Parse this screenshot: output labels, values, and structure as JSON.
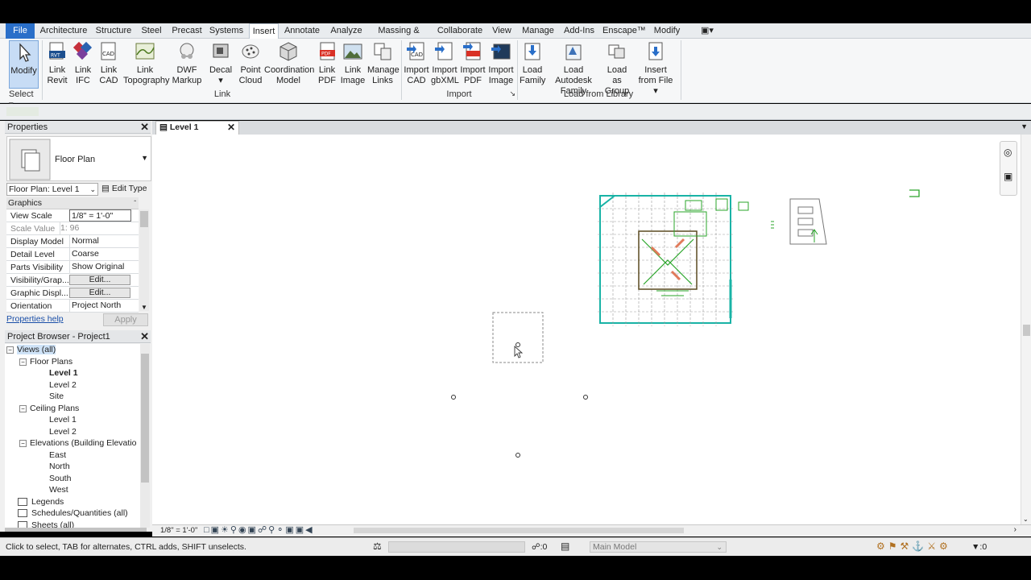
{
  "ribbon_tabs": [
    "File",
    "Architecture",
    "Structure",
    "Steel",
    "Precast",
    "Systems",
    "Insert",
    "Annotate",
    "Analyze",
    "Massing & Site",
    "Collaborate",
    "View",
    "Manage",
    "Add-Ins",
    "Enscape™",
    "Modify"
  ],
  "active_tab": "Insert",
  "buttons": {
    "modify": "Modify",
    "link_revit": [
      "Link",
      "Revit"
    ],
    "link_ifc": [
      "Link",
      "IFC"
    ],
    "link_cad": [
      "Link",
      "CAD"
    ],
    "link_topography": [
      "Link",
      "Topography"
    ],
    "dwf_markup": [
      "DWF",
      "Markup"
    ],
    "decal": "Decal",
    "point_cloud": [
      "Point",
      "Cloud"
    ],
    "coordination_model": [
      "Coordination",
      "Model"
    ],
    "link_pdf": [
      "Link",
      "PDF"
    ],
    "link_image": [
      "Link",
      "Image"
    ],
    "manage_links": [
      "Manage",
      "Links"
    ],
    "import_cad": [
      "Import",
      "CAD"
    ],
    "import_gbxml": [
      "Import",
      "gbXML"
    ],
    "import_pdf": [
      "Import",
      "PDF"
    ],
    "import_image": [
      "Import",
      "Image"
    ],
    "load_family": [
      "Load",
      "Family"
    ],
    "load_autodesk_family": [
      "Load Autodesk",
      "Family"
    ],
    "load_as_group": [
      "Load as",
      "Group"
    ],
    "insert_from_file": [
      "Insert",
      "from File"
    ]
  },
  "groups": {
    "select": "Select",
    "link": "Link",
    "import": "Import",
    "load_from_library": "Load from Library"
  },
  "properties": {
    "title": "Properties",
    "type_name": "Floor Plan",
    "instance_selector": "Floor Plan: Level 1",
    "edit_type": "Edit Type",
    "section": "Graphics",
    "rows": [
      {
        "k": "View Scale",
        "v": "1/8\" = 1'-0\""
      },
      {
        "k": "Scale Value",
        "v": "1: 96"
      },
      {
        "k": "Display Model",
        "v": "Normal"
      },
      {
        "k": "Detail Level",
        "v": "Coarse"
      },
      {
        "k": "Parts Visibility",
        "v": "Show Original"
      },
      {
        "k": "Visibility/Grap...",
        "v": "Edit..."
      },
      {
        "k": "Graphic Displ...",
        "v": "Edit..."
      },
      {
        "k": "Orientation",
        "v": "Project North"
      }
    ],
    "help": "Properties help",
    "apply": "Apply"
  },
  "browser": {
    "title": "Project Browser - Project1",
    "items": [
      "Views (all)",
      "Floor Plans",
      "Level 1",
      "Level 2",
      "Site",
      "Ceiling Plans",
      "Level 1",
      "Level 2",
      "Elevations (Building Elevatio",
      "East",
      "North",
      "South",
      "West",
      "Legends",
      "Schedules/Quantities (all)",
      "Sheets (all)"
    ]
  },
  "doc_tab": "Level 1",
  "view_scale": "1/8\" = 1'-0\"",
  "status": {
    "hint": "Click to select, TAB for alternates, CTRL adds, SHIFT unselects.",
    "count": ":0",
    "model": "Main Model",
    "filter": ":0"
  },
  "colors": {
    "file_tab": "#2a6fc9",
    "selected": "#c7dcf5",
    "plan_cyan": "#19b3a6",
    "plan_green": "#2aa52a"
  }
}
